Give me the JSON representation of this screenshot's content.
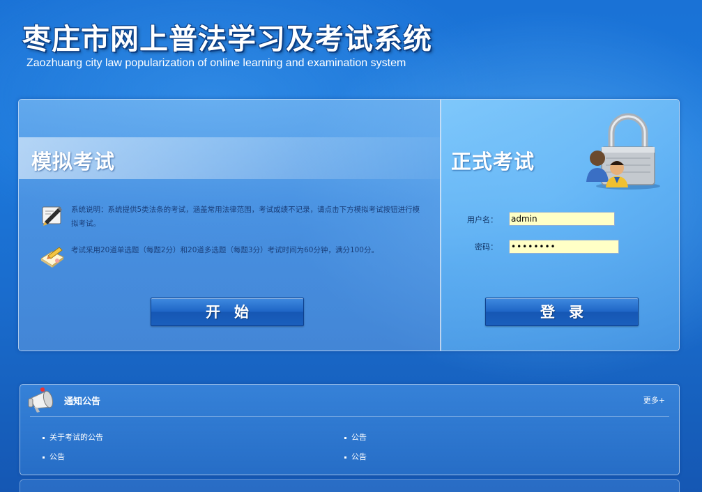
{
  "header": {
    "title": "枣庄市网上普法学习及考试系统",
    "subtitle": "Zaozhuang city law popularization of online learning and examination system"
  },
  "practice": {
    "title": "模拟考试",
    "info": [
      {
        "icon": "pen-icon",
        "text": "系统说明：系统提供5类法条的考试，涵盖常用法律范围，考试成绩不记录，请点击下方模拟考试按钮进行模拟考试。"
      },
      {
        "icon": "document-pencil-icon",
        "text": "考试采用20道单选题（每题2分）和20道多选题（每题3分）考试时间为60分钟，满分100分。"
      }
    ],
    "start_label": "开始"
  },
  "formal": {
    "title": "正式考试",
    "lock_icon": "padlock-users-icon",
    "username_label": "用户名：",
    "username_value": "admin",
    "password_label": "密码：",
    "password_value": "••••••••",
    "login_label": "登录"
  },
  "notice": {
    "title": "通知公告",
    "icon": "megaphone-icon",
    "more_label": "更多+",
    "items": [
      {
        "label": "关于考试的公告"
      },
      {
        "label": "公告"
      },
      {
        "label": "公告"
      },
      {
        "label": "公告"
      }
    ]
  },
  "colors": {
    "background": "#1a72d6",
    "input_background": "#ffffc6",
    "button": "#1f66c6"
  }
}
